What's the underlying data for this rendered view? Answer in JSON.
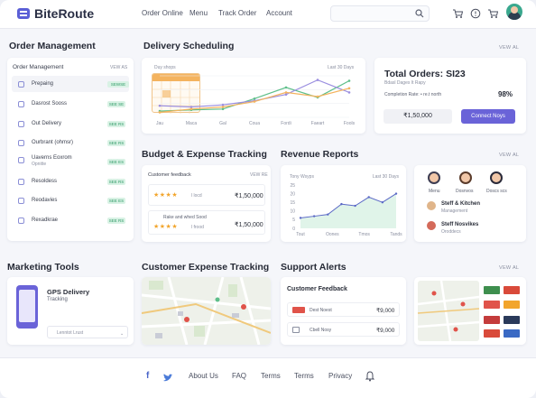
{
  "header": {
    "brand": "BiteRoute",
    "nav": [
      "Order Online",
      "Menu",
      "Track Order",
      "Account"
    ],
    "icons": [
      "cart-icon",
      "help-icon",
      "cart-icon",
      "avatar"
    ]
  },
  "sections": {
    "order_management": "Order Management",
    "delivery_scheduling": "Delivery Scheduling",
    "view_all": "VEW AL",
    "budget": "Budget & Expense Tracking",
    "revenue": "Revenue Reports",
    "marketing": "Marketing Tools",
    "customer_expense": "Customer Expense Tracking",
    "support": "Support Alerts"
  },
  "order_card": {
    "title": "Order Management",
    "right_label": "VEW AS",
    "rows": [
      {
        "label": "Prepaing",
        "badge": "SEWSE"
      },
      {
        "label": "Dasrost Sooss",
        "badge": "SEE SE"
      },
      {
        "label": "Out Delivery",
        "badge": "SEE RS"
      },
      {
        "label": "Ourbrant (ohmsr)",
        "badge": "SEE RS"
      },
      {
        "label": "Uaverns Eoxrom",
        "sub": "Opnitte",
        "badge": "SEE ES"
      },
      {
        "label": "Resoldess",
        "badge": "SEE RS"
      },
      {
        "label": "Reodavies",
        "badge": "SEE ES"
      },
      {
        "label": "Rexadkrae",
        "badge": "SEE RS"
      }
    ]
  },
  "delivery_chart": {
    "label_left": "Duy shops",
    "label_right": "Last 30 Days"
  },
  "chart_data": [
    {
      "type": "line",
      "x": [
        "Jau",
        "Maca",
        "Gal",
        "Coua",
        "Fordi",
        "Faeart",
        "Fools"
      ],
      "series": [
        {
          "color": "#5ebf8a",
          "values": [
            15,
            18,
            20,
            45,
            72,
            48,
            88
          ]
        },
        {
          "color": "#9b8fe0",
          "values": [
            28,
            25,
            30,
            40,
            55,
            90,
            60
          ]
        },
        {
          "color": "#f4b35e",
          "values": [
            12,
            20,
            25,
            38,
            60,
            50,
            70
          ]
        }
      ],
      "ylim": [
        0,
        100
      ]
    },
    {
      "type": "area",
      "title": "Tony Wsyps",
      "subtitle": "Last 30 Days",
      "x": [
        "Tout",
        "Oones",
        "Tmos",
        "Tands"
      ],
      "yticks": [
        "25",
        "20",
        "15",
        "10",
        "5",
        "0"
      ],
      "values": [
        6,
        7,
        8,
        14,
        13,
        18,
        15,
        20
      ],
      "ylim": [
        0,
        25
      ]
    }
  ],
  "totals": {
    "title": "Total Orders: SI23",
    "sub": "Bdasl Dages It Rapy",
    "completion_label": "Completion Rate: • re.t north",
    "completion_value": "98%",
    "amount": "₹1,50,000",
    "button": "Connect Noys"
  },
  "budget_card": {
    "title": "Customer feedback",
    "right": "VEW RE",
    "rows": [
      {
        "label": "",
        "sub": "l locd",
        "value": "₹1,50,000"
      },
      {
        "label": "Rake and whed Sood",
        "sub": "l frood",
        "value": "₹1,50,000"
      }
    ]
  },
  "staff_card": {
    "people": [
      "Menu",
      "Dosnvos",
      "Doscs scs"
    ],
    "items": [
      {
        "title": "Steff & Kitchen",
        "sub": "Management"
      },
      {
        "title": "Steff Nosvikes",
        "sub": "Oroddecs"
      }
    ]
  },
  "marketing_card": {
    "title": "GPS Delivery",
    "sub": "Tracking",
    "hint": "Lenntot Lrust"
  },
  "support_card": {
    "title": "Customer Feedback",
    "rows": [
      {
        "label": "Dest Noest",
        "value": "₹9,000"
      },
      {
        "label": "Cbell Nosy",
        "value": "₹9,000"
      }
    ]
  },
  "footer": {
    "links": [
      "About Us",
      "FAQ",
      "Terms",
      "Terms",
      "Privacy"
    ]
  },
  "colors": {
    "accent": "#6a63d8",
    "green": "#5ebf8a",
    "purple": "#9b8fe0",
    "orange": "#f4b35e"
  }
}
